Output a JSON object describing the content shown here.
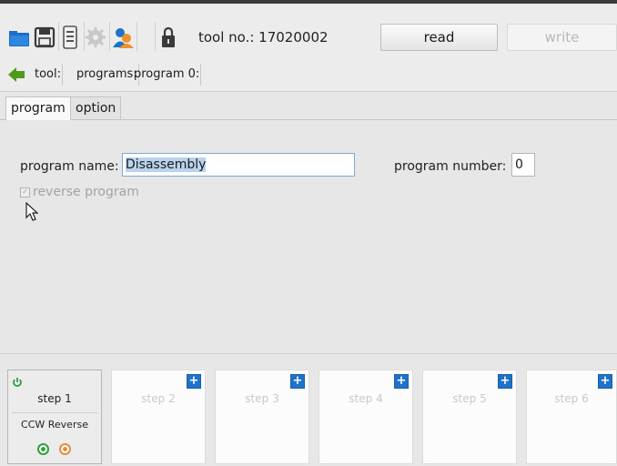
{
  "toolbar": {
    "icons": [
      "folder-icon",
      "save-icon",
      "device-icon",
      "gear-icon",
      "user-icon",
      "lock-icon"
    ],
    "tool_no": "tool no.: 17020002",
    "read_label": "read",
    "write_label": "write"
  },
  "breadcrumb": [
    "tool:",
    "programs:",
    "program 0:"
  ],
  "tabs": [
    "program",
    "option"
  ],
  "form": {
    "program_name_label": "program name:",
    "program_name_value": "Disassembly",
    "program_number_label": "program number:",
    "program_number_value": "0",
    "reverse_label": "reverse program"
  },
  "steps": [
    {
      "label": "step 1",
      "subtitle": "CCW Reverse"
    },
    {
      "label": "step 2"
    },
    {
      "label": "step 3"
    },
    {
      "label": "step 4"
    },
    {
      "label": "step 5"
    },
    {
      "label": "step 6"
    }
  ],
  "colors": {
    "accent": "#1f72c9",
    "power_green": "#2e9f3c",
    "status_orange": "#e58a3c"
  }
}
